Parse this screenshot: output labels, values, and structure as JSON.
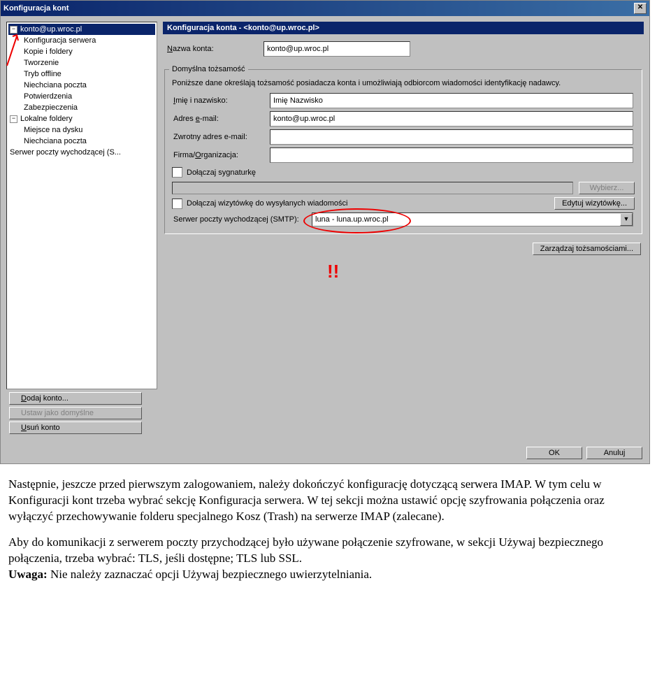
{
  "window": {
    "title": "Konfiguracja kont"
  },
  "tree": {
    "root1": {
      "label": "konto@up.wroc.pl"
    },
    "items1": [
      "Konfiguracja serwera",
      "Kopie i foldery",
      "Tworzenie",
      "Tryb offline",
      "Niechciana poczta",
      "Potwierdzenia",
      "Zabezpieczenia"
    ],
    "root2": {
      "label": "Lokalne foldery"
    },
    "items2": [
      "Miejsce na dysku",
      "Niechciana poczta"
    ],
    "smtp": "Serwer poczty wychodzącej (S..."
  },
  "left_buttons": {
    "add": "Dodaj konto...",
    "default": "Ustaw jako domyślne",
    "remove": "Usuń konto"
  },
  "panel": {
    "title": "Konfiguracja konta - <konto@up.wroc.pl>",
    "acct_label": "Nazwa konta:",
    "acct_value": "konto@up.wroc.pl",
    "identity": {
      "legend": "Domyślna tożsamość",
      "hint": "Poniższe dane określają tożsamość posiadacza konta i umożliwiają odbiorcom wiadomości identyfikację nadawcy.",
      "name_label": "Imię i nazwisko:",
      "name_value": "Imię Nazwisko",
      "email_label": "Adres e-mail:",
      "email_value": "konto@up.wroc.pl",
      "reply_label": "Zwrotny adres e-mail:",
      "org_label": "Firma/Organizacja:",
      "sig_check": "Dołączaj sygnaturkę",
      "choose_btn": "Wybierz...",
      "vcard_check": "Dołączaj wizytówkę do wysyłanych wiadomości",
      "vcard_btn": "Edytuj wizytówkę...",
      "smtp_label": "Serwer poczty wychodzącej (SMTP):",
      "smtp_value": "luna - luna.up.wroc.pl"
    },
    "manage_btn": "Zarządzaj tożsamościami..."
  },
  "bottom": {
    "ok": "OK",
    "cancel": "Anuluj"
  },
  "annotation": {
    "exclaim": "!!"
  },
  "doc": {
    "p1": "Następnie, jeszcze przed pierwszym zalogowaniem, należy dokończyć konfigurację dotyczącą serwera IMAP. W tym celu w Konfiguracji kont trzeba wybrać sekcję Konfiguracja serwera. W tej sekcji można ustawić opcję szyfrowania połączenia oraz wyłączyć przechowywanie folderu specjalnego Kosz (Trash) na serwerze IMAP (zalecane).",
    "p2a": "Aby do komunikacji z serwerem poczty przychodzącej było używane połączenie szyfrowane, w sekcji Używaj bezpiecznego połączenia, trzeba wybrać: TLS, jeśli dostępne; TLS lub SSL.",
    "p2b": "Uwaga:",
    "p2c": " Nie należy zaznaczać opcji Używaj bezpiecznego uwierzytelniania."
  }
}
